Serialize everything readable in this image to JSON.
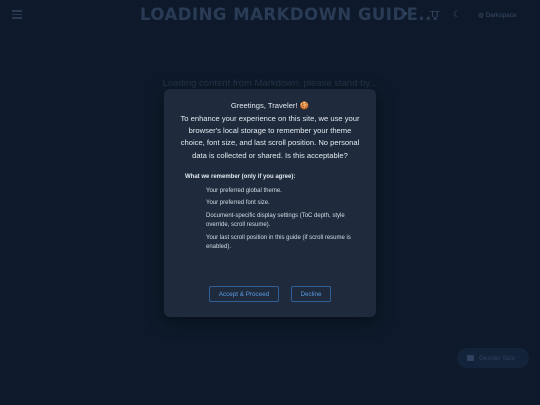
{
  "header": {
    "title": "LOADING MARKDOWN GUIDE...",
    "font_icon": "TT",
    "theme_icon": "☾",
    "theme_select": "Darkspace"
  },
  "main": {
    "loading": "Loading content from Markdown, please stand by..."
  },
  "fab": {
    "label": "Gender Size"
  },
  "modal": {
    "greeting": "Greetings, Traveler! 🍪",
    "intro": "To enhance your experience on this site, we use your browser's local storage to remember your theme choice, font size, and last scroll position. No personal data is collected or shared. Is this acceptable?",
    "remember_heading": "What we remember (only if you agree):",
    "items": [
      "Your preferred global theme.",
      "Your preferred font size.",
      "Document-specific display settings (ToC depth, style override, scroll resume).",
      "Your last scroll position in this guide (if scroll resume is enabled)."
    ],
    "accept_label": "Accept & Proceed",
    "decline_label": "Decline"
  }
}
